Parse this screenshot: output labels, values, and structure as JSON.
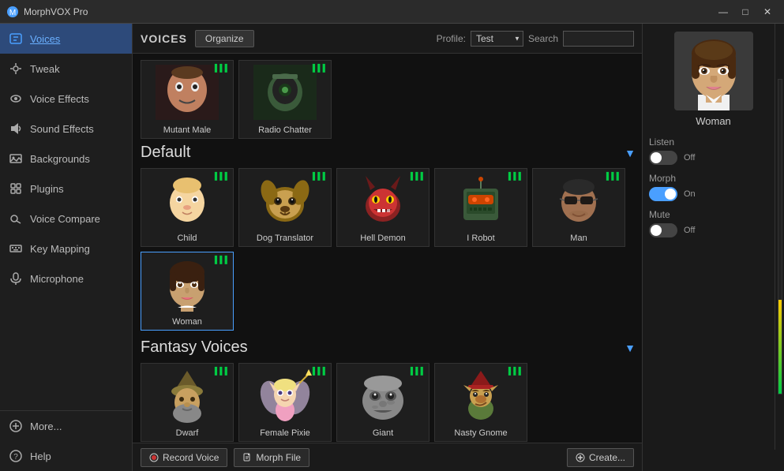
{
  "app": {
    "title": "MorphVOX Pro",
    "icon": "🎤"
  },
  "titlebar": {
    "minimize": "—",
    "maximize": "□",
    "close": "✕"
  },
  "sidebar": {
    "items": [
      {
        "id": "voices",
        "label": "Voices",
        "icon": "🎙",
        "active": true
      },
      {
        "id": "tweak",
        "label": "Tweak",
        "icon": "🔧",
        "active": false
      },
      {
        "id": "voice-effects",
        "label": "Voice Effects",
        "icon": "🎭",
        "active": false
      },
      {
        "id": "sound-effects",
        "label": "Sound Effects",
        "icon": "🔊",
        "active": false
      },
      {
        "id": "backgrounds",
        "label": "Backgrounds",
        "icon": "🌄",
        "active": false
      },
      {
        "id": "plugins",
        "label": "Plugins",
        "icon": "🔌",
        "active": false
      },
      {
        "id": "voice-compare",
        "label": "Voice Compare",
        "icon": "🔍",
        "active": false
      },
      {
        "id": "key-mapping",
        "label": "Key Mapping",
        "icon": "⌨",
        "active": false
      },
      {
        "id": "microphone",
        "label": "Microphone",
        "icon": "🎤",
        "active": false
      }
    ],
    "bottom": [
      {
        "id": "more",
        "label": "More...",
        "icon": "⊕"
      },
      {
        "id": "help",
        "label": "Help",
        "icon": "?"
      }
    ]
  },
  "topbar": {
    "title": "VOICES",
    "organize_label": "Organize",
    "profile_label": "Profile:",
    "profile_value": "Test",
    "search_label": "Search"
  },
  "pinned_voices": [
    {
      "id": "mutant-male",
      "name": "Mutant Male",
      "color": "#2a1a1a"
    },
    {
      "id": "radio-chatter",
      "name": "Radio Chatter",
      "color": "#1a2a1a"
    }
  ],
  "sections": [
    {
      "id": "default",
      "title": "Default",
      "voices": [
        {
          "id": "child",
          "name": "Child",
          "color": "#f5d5a0",
          "type": "human"
        },
        {
          "id": "dog-translator",
          "name": "Dog Translator",
          "color": "#8b6914",
          "type": "animal"
        },
        {
          "id": "hell-demon",
          "name": "Hell Demon",
          "color": "#8b2222",
          "type": "demon"
        },
        {
          "id": "i-robot",
          "name": "I Robot",
          "color": "#3a5a3a",
          "type": "robot"
        },
        {
          "id": "man",
          "name": "Man",
          "color": "#3a3a5a",
          "type": "human"
        },
        {
          "id": "woman",
          "name": "Woman",
          "color": "#c8a070",
          "type": "human"
        }
      ]
    },
    {
      "id": "fantasy",
      "title": "Fantasy Voices",
      "voices": [
        {
          "id": "dwarf",
          "name": "Dwarf",
          "color": "#4a4a2a",
          "type": "fantasy"
        },
        {
          "id": "female-pixie",
          "name": "Female Pixie",
          "color": "#c8a8d0",
          "type": "fantasy"
        },
        {
          "id": "giant",
          "name": "Giant",
          "color": "#888888",
          "type": "fantasy"
        },
        {
          "id": "nasty-gnome",
          "name": "Nasty Gnome",
          "color": "#5a7a3a",
          "type": "fantasy"
        }
      ]
    }
  ],
  "right_panel": {
    "selected_voice": "Woman",
    "listen": {
      "label": "Listen",
      "state": "Off",
      "on": false
    },
    "morph": {
      "label": "Morph",
      "state": "On",
      "on": true
    },
    "mute": {
      "label": "Mute",
      "state": "Off",
      "on": false
    }
  },
  "bottombar": {
    "record_label": "Record Voice",
    "morph_label": "Morph File",
    "create_label": "Create..."
  }
}
